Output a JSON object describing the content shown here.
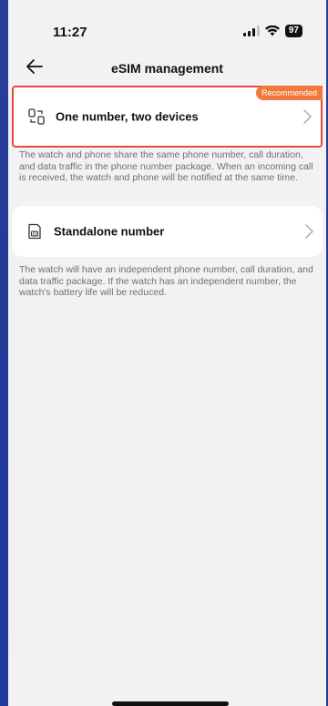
{
  "status_bar": {
    "time": "11:27",
    "battery": "97",
    "icons": [
      "signal-icon",
      "wifi-icon",
      "battery-icon"
    ]
  },
  "nav": {
    "back_icon": "back-arrow-icon",
    "title": "eSIM management"
  },
  "options": [
    {
      "icon": "multi-device-icon",
      "label": "One number, two devices",
      "badge": "Recommended",
      "description": "The watch and phone share the same phone number, call duration, and data traffic in the phone number package. When an incoming call is received, the watch and phone will be notified at the same time."
    },
    {
      "icon": "sim-card-icon",
      "label": "Standalone number",
      "description": "The watch will have an independent phone number, call duration, and data traffic package. If the watch has an independent number, the watch's battery life will be reduced."
    }
  ],
  "colors": {
    "highlight_border": "#e54a3e",
    "badge": "#f07a3c",
    "background": "#f2f2f4"
  }
}
